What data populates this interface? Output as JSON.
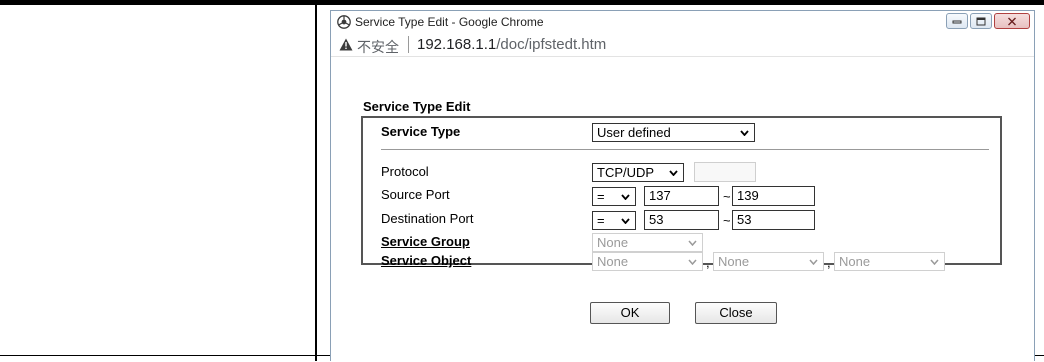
{
  "window": {
    "title": "Service Type Edit - Google Chrome",
    "insecure_label": "不安全",
    "url_host": "192.168.1.1",
    "url_path": "/doc/ipfstedt.htm"
  },
  "form": {
    "heading": "Service Type Edit",
    "service_type": {
      "label": "Service Type",
      "value": "User defined"
    },
    "protocol": {
      "label": "Protocol",
      "value": "TCP/UDP",
      "extra_value": ""
    },
    "source_port": {
      "label": "Source Port",
      "operator": "=",
      "start": "137",
      "end": "139"
    },
    "destination_port": {
      "label": "Destination Port",
      "operator": "=",
      "start": "53",
      "end": "53"
    },
    "service_group": {
      "label": "Service Group",
      "value": "None"
    },
    "service_object": {
      "label": "Service Object",
      "values": [
        "None",
        "None",
        "None"
      ]
    },
    "tilde": "~",
    "comma": ","
  },
  "buttons": {
    "ok": "OK",
    "close": "Close"
  }
}
